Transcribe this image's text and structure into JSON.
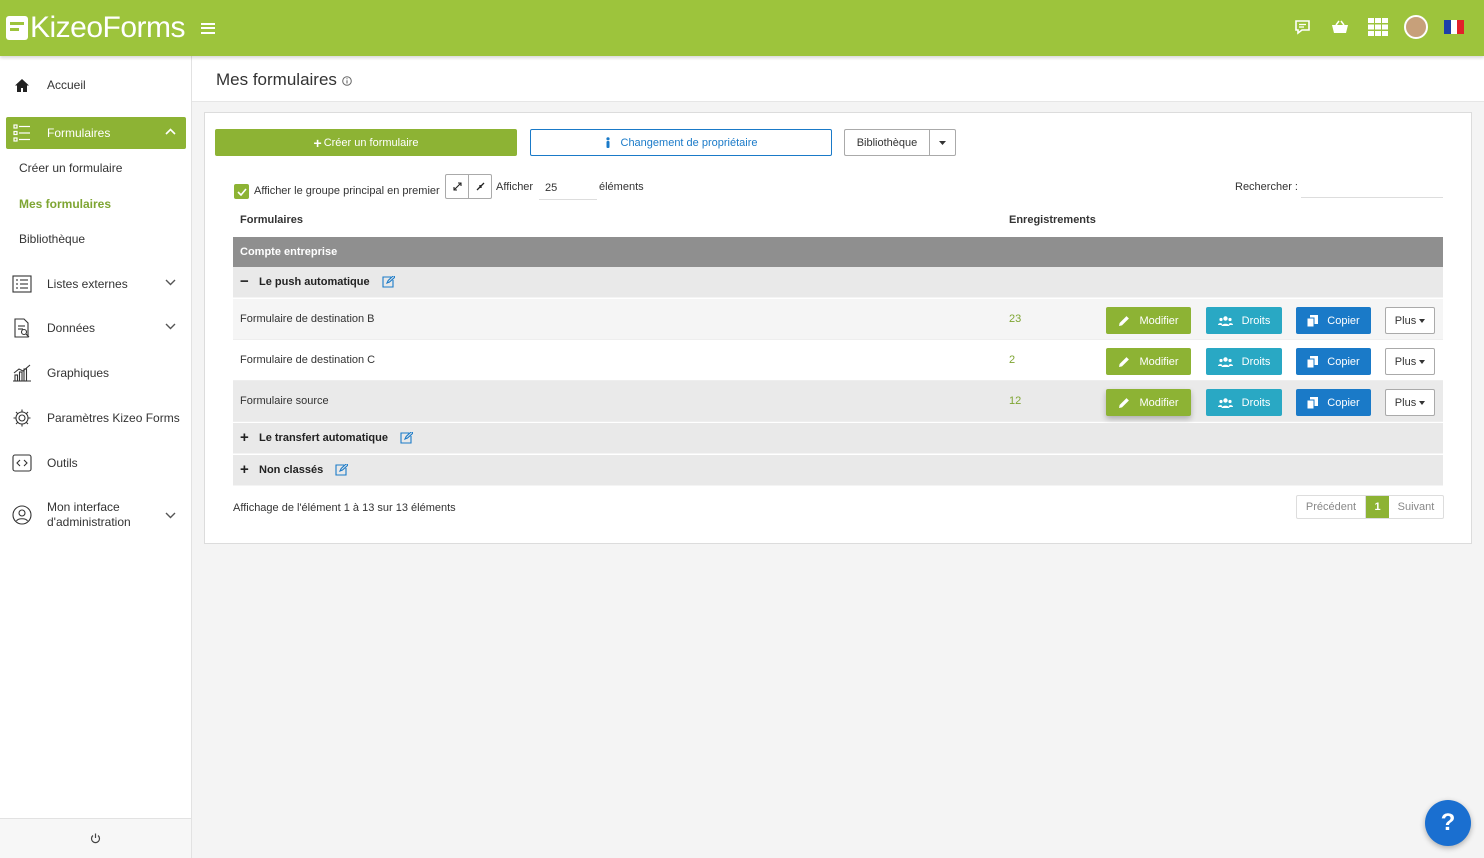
{
  "app": {
    "logo_text": "KizeoForms"
  },
  "topbar": {
    "icons": [
      "chat-icon",
      "basket-icon",
      "apps-grid-icon",
      "user-avatar",
      "flag-fr-icon"
    ]
  },
  "sidebar": {
    "items": [
      {
        "label": "Accueil",
        "icon": "home-icon"
      },
      {
        "label": "Formulaires",
        "icon": "forms-list-icon"
      },
      {
        "label": "Listes externes",
        "icon": "list-icon"
      },
      {
        "label": "Données",
        "icon": "data-icon"
      },
      {
        "label": "Graphiques",
        "icon": "chart-icon"
      },
      {
        "label": "Paramètres Kizeo Forms",
        "icon": "gear-icon"
      },
      {
        "label": "Outils",
        "icon": "tools-icon"
      },
      {
        "label": "Mon interface d'administration",
        "label_line1": "Mon interface",
        "label_line2": "d'administration",
        "icon": "admin-icon"
      }
    ],
    "sub_items": [
      {
        "label": "Créer un formulaire"
      },
      {
        "label": "Mes formulaires"
      },
      {
        "label": "Bibliothèque"
      }
    ]
  },
  "header": {
    "title": "Mes formulaires"
  },
  "toolbar": {
    "create_label": "Créer un formulaire",
    "owner_label": "Changement de propriétaire",
    "library_label": "Bibliothèque"
  },
  "filters": {
    "main_group_first_label": "Afficher le groupe principal en premier",
    "show_label": "Afficher",
    "show_value": "25",
    "elements_label": "éléments",
    "search_label": "Rechercher :"
  },
  "table": {
    "headers": {
      "forms": "Formulaires",
      "records": "Enregistrements"
    },
    "company": "Compte entreprise",
    "groups": [
      {
        "name": "Le push automatique",
        "sign": "−"
      },
      {
        "name": "Le transfert automatique",
        "sign": "+"
      },
      {
        "name": "Non classés",
        "sign": "+"
      }
    ],
    "rows": [
      {
        "name": "Formulaire de destination B",
        "count": "23"
      },
      {
        "name": "Formulaire de destination C",
        "count": "2"
      },
      {
        "name": "Formulaire source",
        "count": "12"
      }
    ],
    "actions": {
      "modify": "Modifier",
      "rights": "Droits",
      "copy": "Copier",
      "more": "Plus"
    }
  },
  "pagination": {
    "info": "Affichage de l'élément 1 à 13 sur 13 éléments",
    "prev": "Précédent",
    "page": "1",
    "next": "Suivant"
  },
  "help": {
    "label": "?"
  },
  "colors": {
    "brand_green": "#9dc43c",
    "button_green": "#8db334",
    "teal": "#29a8c4",
    "blue": "#1a7ac8"
  }
}
